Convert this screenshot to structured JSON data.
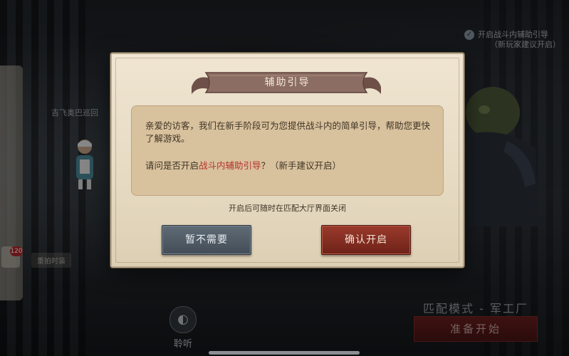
{
  "top_toggle": {
    "label": "开启战斗内辅助引导",
    "sublabel": "（新玩家建议开启）",
    "checked": true
  },
  "background": {
    "left_label": "吉飞奥巴巡回",
    "left_bubble_label": "重拍时装",
    "badge_count": "120",
    "mode_text": "匹配模式 - 军工厂",
    "start_button": "准备开始",
    "listen_label": "聆听"
  },
  "dialog": {
    "title": "辅助引导",
    "message": "亲爱的访客，我们在新手阶段可为您提供战斗内的简单引导，帮助您更快了解游戏。",
    "question_prefix": "请问是否开启",
    "question_highlight": "战斗内辅助引导",
    "question_suffix": "？（新手建议开启）",
    "note": "开启后可随时在匹配大厅界面关闭",
    "cancel_button": "暂不需要",
    "confirm_button": "确认开启"
  },
  "colors": {
    "parchment": "#e6dac2",
    "message_box": "#d8c19d",
    "highlight": "#b5322c",
    "cancel": "#4d5862",
    "confirm": "#7f2a1f",
    "banner": "#8c6d63"
  },
  "icons": [
    "check-icon",
    "ear-icon"
  ]
}
